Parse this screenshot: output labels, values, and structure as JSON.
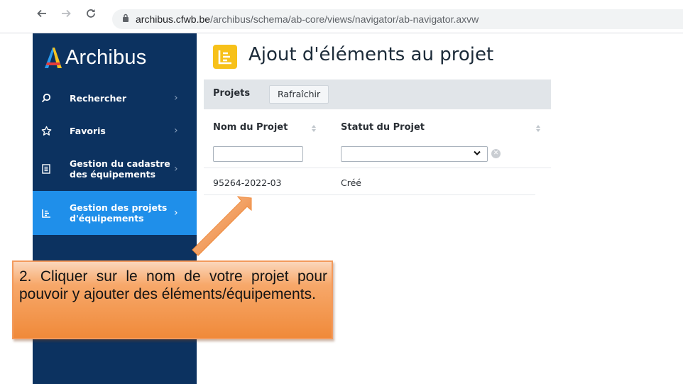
{
  "browser": {
    "url_host": "archibus.cfwb.be",
    "url_path": "/archibus/schema/ab-core/views/navigator/ab-navigator.axvw"
  },
  "sidebar": {
    "logo_text": "Archibus",
    "items": [
      {
        "label": "Rechercher",
        "icon": "search-icon"
      },
      {
        "label": "Favoris",
        "icon": "star-icon"
      },
      {
        "label_line1": "Gestion du cadastre",
        "label_line2": "des équipements",
        "icon": "inventory-icon"
      },
      {
        "label_line1": "Gestion des projets",
        "label_line2": "d'équipements",
        "icon": "projects-icon",
        "active": true
      }
    ]
  },
  "main": {
    "title": "Ajout d'éléments au projet",
    "panel": {
      "title": "Projets",
      "refresh_label": "Rafraîchir",
      "columns": [
        "Nom du Projet",
        "Statut du Projet"
      ],
      "rows": [
        {
          "name": "95264-2022-03",
          "status": "Créé"
        }
      ]
    }
  },
  "callout": {
    "text": "2. Cliquer sur le nom de votre projet pour pouvoir y ajouter des éléments/équipements."
  },
  "colors": {
    "sidebar_bg": "#0c3260",
    "active_item": "#1f8fea",
    "title_icon": "#f7c11a",
    "callout_orange": "#f08a3a"
  }
}
